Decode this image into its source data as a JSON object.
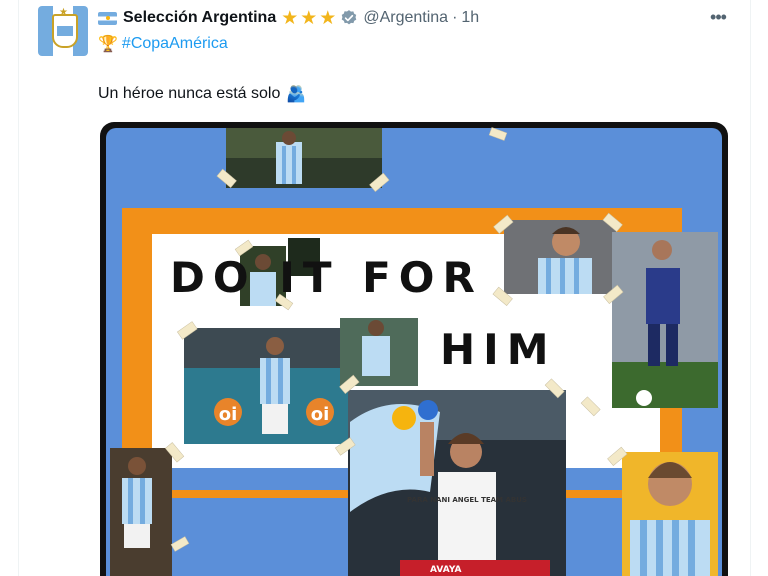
{
  "tweet": {
    "display_name": "Selección Argentina",
    "stars": "★★★",
    "handle": "@Argentina",
    "separator": "·",
    "time": "1h",
    "hashtag": "#CopaAmérica",
    "text": "Un héroe nunca está solo",
    "text_emoji": "🫂",
    "more_label": "•••",
    "media": {
      "headline_line1": "DO IT FOR",
      "headline_line2": "HIM",
      "shirt_lettering": "PARA NANI ANGEL TEAM ABUS",
      "sponsor_lettering": "oi",
      "banner_lettering": "AVAYA"
    }
  },
  "colors": {
    "accent": "#1d9bf0",
    "muted": "#536471",
    "poster_blue": "#5b8fd9",
    "poster_orange": "#f29018",
    "argentina_blue": "#74acdf"
  },
  "icons": {
    "flag": "argentina-flag-icon",
    "verified": "verified-badge-icon",
    "trophy": "trophy-icon",
    "more": "more-options-icon"
  }
}
